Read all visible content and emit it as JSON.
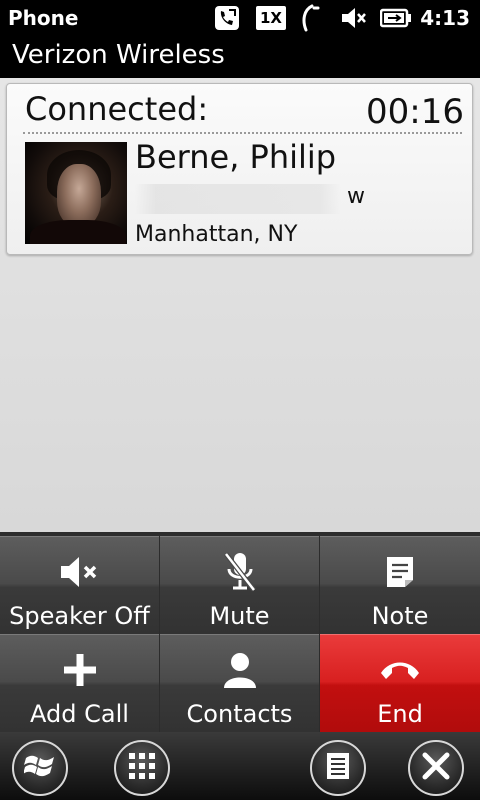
{
  "status_bar": {
    "app_name": "Phone",
    "network_label": "1X",
    "time": "4:13",
    "icons": [
      "call-forwarding-icon",
      "network-1x-icon",
      "signal-icon",
      "speaker-muted-icon",
      "battery-charging-icon"
    ]
  },
  "carrier": "Verizon Wireless",
  "call": {
    "status": "Connected:",
    "timer": "00:16",
    "contact_name": "Berne, Philip",
    "number_type": "w",
    "location": "Manhattan, NY"
  },
  "actions": {
    "speaker": "Speaker Off",
    "mute": "Mute",
    "note": "Note",
    "add_call": "Add Call",
    "contacts": "Contacts",
    "end": "End"
  },
  "softkeys": {
    "icons": [
      "windows-start-icon",
      "keypad-icon",
      "menu-icon",
      "close-icon"
    ]
  },
  "colors": {
    "end_button": "#d82020",
    "action_button": "#4a4a4a",
    "card_background": "#f5f5f5"
  }
}
